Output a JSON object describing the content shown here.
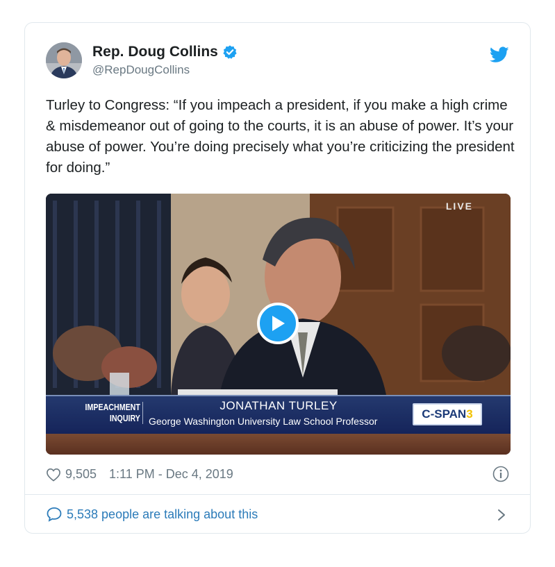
{
  "tweet": {
    "author_name": "Rep. Doug Collins",
    "handle": "@RepDougCollins",
    "verified": true,
    "text": "Turley to Congress: “If you impeach a president, if you make a high crime & misdemeanor out of going to the courts, it is an abuse of power. It’s your abuse of power. You’re doing precisely what you’re criticizing the president for doing.”",
    "likes": "9,505",
    "timestamp": "1:11 PM - Dec 4, 2019",
    "talking": "5,538 people are talking about this"
  },
  "video": {
    "live_label": "LIVE",
    "tag_line1": "IMPEACHMENT",
    "tag_line2": "INQUIRY",
    "guest_name": "JONATHAN TURLEY",
    "guest_title": "George Washington University Law School Professor",
    "network_prefix": "C-SPAN",
    "network_number": "3"
  },
  "icons": {
    "brand": "twitter-bird-icon",
    "verified": "verified-badge-icon",
    "like": "heart-icon",
    "info": "info-icon",
    "reply": "speech-bubble-icon",
    "play": "play-icon",
    "chevron": "chevron-right-icon"
  },
  "colors": {
    "accent": "#1da1f2",
    "link": "#2b7bb9",
    "muted": "#697882",
    "text": "#1c2022",
    "border": "#e1e8ed"
  }
}
